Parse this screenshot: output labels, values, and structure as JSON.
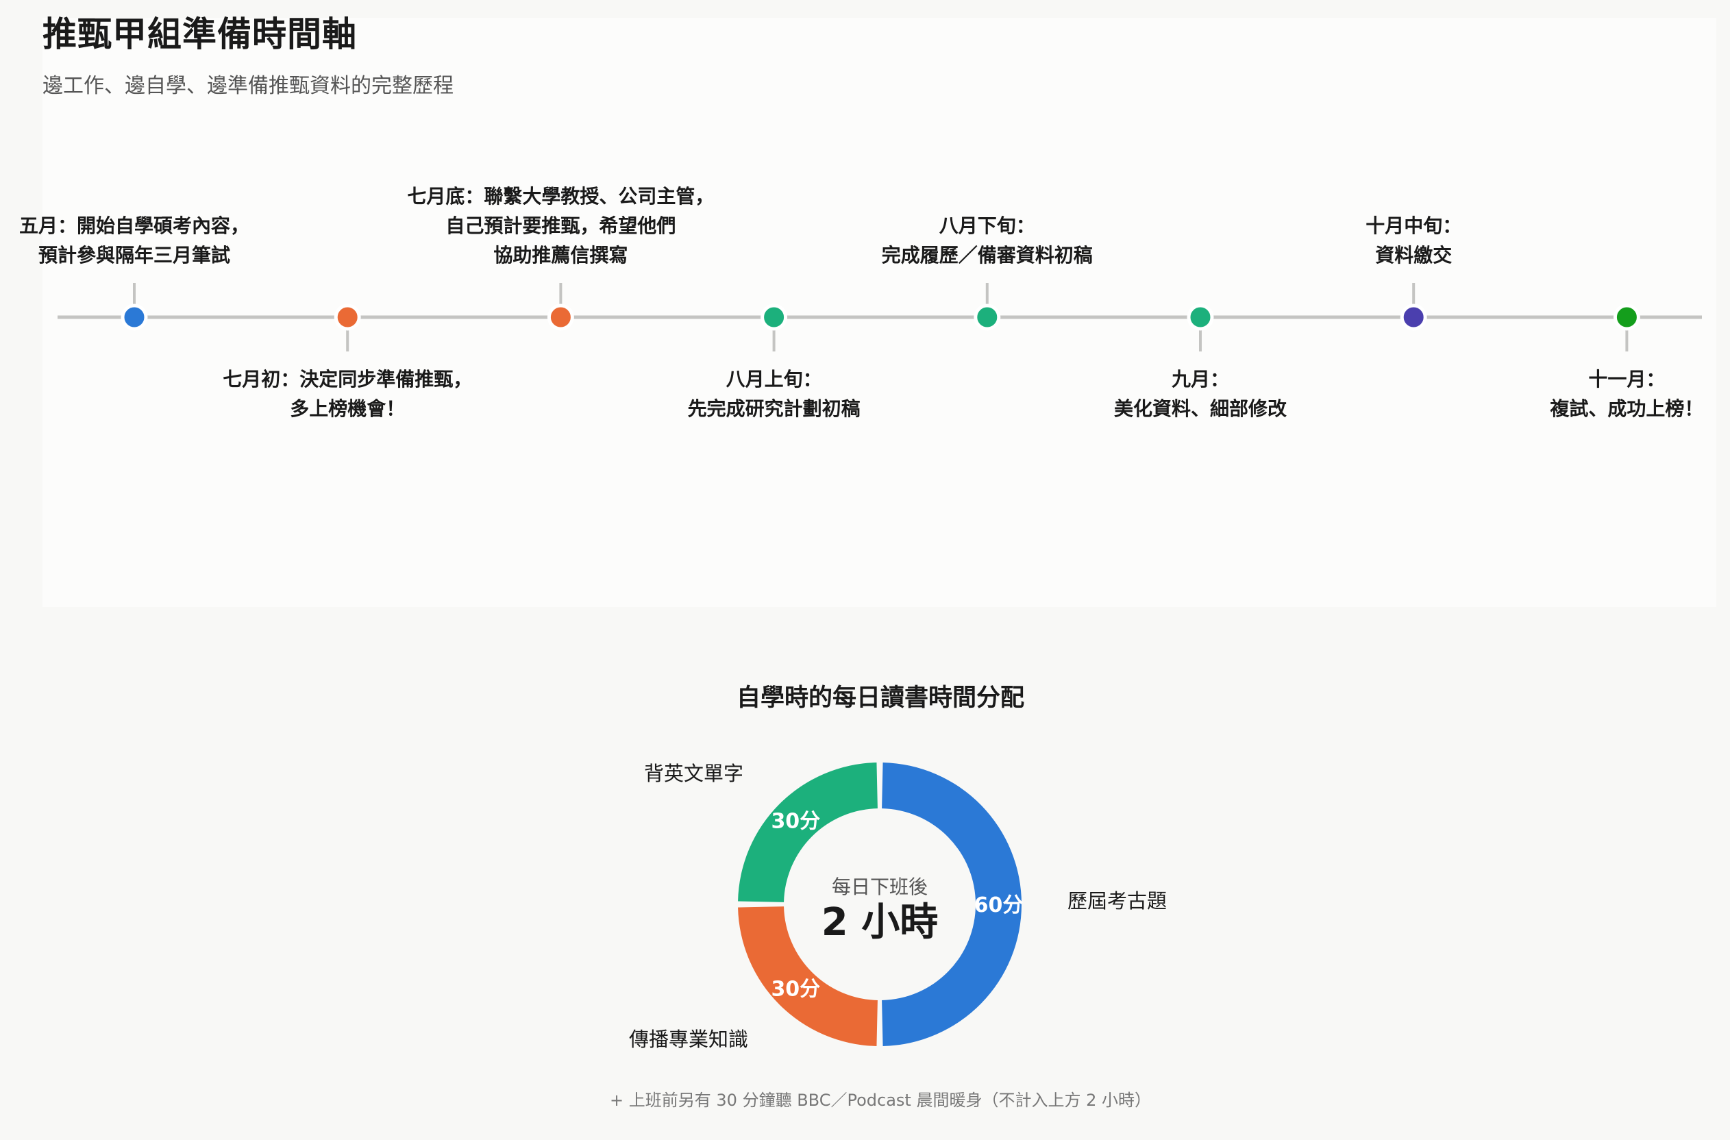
{
  "header": {
    "title": "推甄甲組準備時間軸",
    "subtitle": "邊工作、邊自學、邊準備推甄資料的完整歷程"
  },
  "timeline": {
    "events": [
      {
        "lines": [
          "五月：開始自學碩考內容，",
          "預計參與隔年三月筆試"
        ],
        "color": "#2b79d6",
        "side": "top"
      },
      {
        "lines": [
          "七月初：決定同步準備推甄，",
          "多上榜機會！"
        ],
        "color": "#ea6a35",
        "side": "bottom"
      },
      {
        "lines": [
          "七月底：聯繫大學教授、公司主管，",
          "自己預計要推甄，希望他們",
          "協助推薦信撰寫"
        ],
        "color": "#ea6a35",
        "side": "top"
      },
      {
        "lines": [
          "八月上旬：",
          "先完成研究計劃初稿"
        ],
        "color": "#1cb07c",
        "side": "bottom"
      },
      {
        "lines": [
          "八月下旬：",
          "完成履歷／備審資料初稿"
        ],
        "color": "#1cb07c",
        "side": "top"
      },
      {
        "lines": [
          "九月：",
          "美化資料、細部修改"
        ],
        "color": "#1cb07c",
        "side": "bottom"
      },
      {
        "lines": [
          "十月中旬：",
          "資料繳交"
        ],
        "color": "#4b3fae",
        "side": "top"
      },
      {
        "lines": [
          "十一月：",
          "複試、成功上榜！"
        ],
        "color": "#149e1c",
        "side": "bottom"
      }
    ]
  },
  "chart_data": {
    "type": "pie",
    "title": "自學時的每日讀書時間分配",
    "center_caption": "每日下班後",
    "center_value": "2 小時",
    "unit": "分鐘",
    "slices": [
      {
        "category": "歷屆考古題",
        "value": 60,
        "label": "60分",
        "color": "#2b79d6"
      },
      {
        "category": "傳播專業知識",
        "value": 30,
        "label": "30分",
        "color": "#ea6a35"
      },
      {
        "category": "背英文單字",
        "value": 30,
        "label": "30分",
        "color": "#1cb07c"
      }
    ]
  },
  "footnote": "+ 上班前另有 30 分鐘聽 BBC／Podcast 晨間暖身（不計入上方 2 小時）"
}
